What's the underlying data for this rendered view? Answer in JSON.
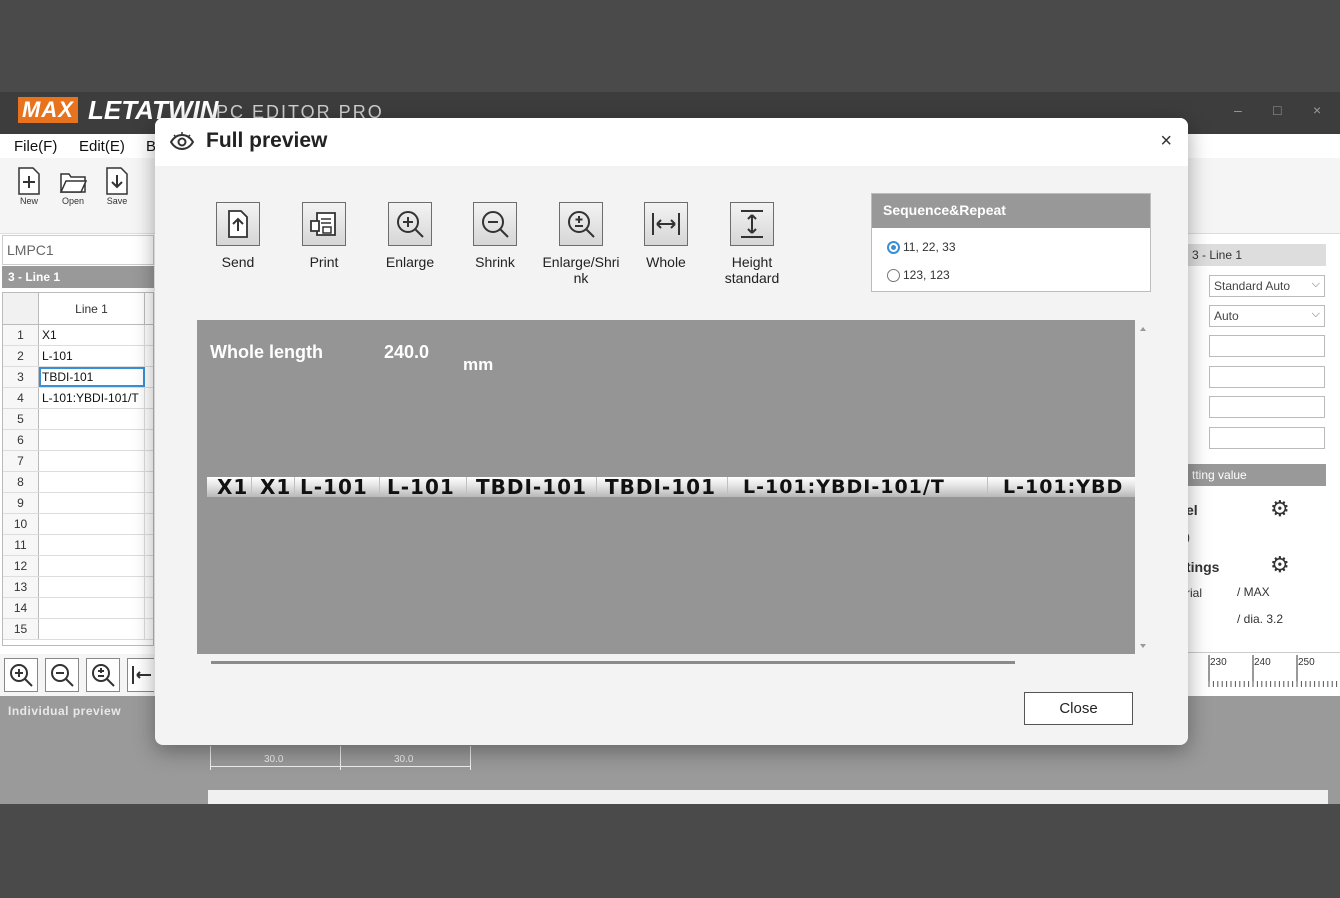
{
  "app": {
    "logo_max": "MAX",
    "logo_name": "LETATWIN",
    "logo_sub": "PC EDITOR PRO",
    "window_controls": [
      "–",
      "□",
      "×"
    ]
  },
  "menu": [
    "File(F)",
    "Edit(E)",
    "B"
  ],
  "toolbar": {
    "new_label": "New",
    "open_label": "Open",
    "save_label": "Save"
  },
  "file_name": "LMPC1",
  "section_header": "3 - Line 1",
  "grid": {
    "column_header": "Line 1",
    "rows": [
      {
        "n": "1",
        "v": "X1"
      },
      {
        "n": "2",
        "v": "L-101"
      },
      {
        "n": "3",
        "v": "TBDI-101"
      },
      {
        "n": "4",
        "v": "L-101:YBDI-101/T"
      },
      {
        "n": "5",
        "v": ""
      },
      {
        "n": "6",
        "v": ""
      },
      {
        "n": "7",
        "v": ""
      },
      {
        "n": "8",
        "v": ""
      },
      {
        "n": "9",
        "v": ""
      },
      {
        "n": "10",
        "v": ""
      },
      {
        "n": "11",
        "v": ""
      },
      {
        "n": "12",
        "v": ""
      },
      {
        "n": "13",
        "v": ""
      },
      {
        "n": "14",
        "v": ""
      },
      {
        "n": "15",
        "v": ""
      }
    ]
  },
  "individual_preview": {
    "label": "Individual preview",
    "dims": [
      "30.0",
      "30.0"
    ]
  },
  "right_panel": {
    "header": "3 - Line 1",
    "select1": "Standard Auto",
    "select2": "Auto",
    "setting_header": "tting value",
    "label_frag": "el",
    "paren_frag": ")",
    "settings_frag": "tings",
    "material_frag": "rial",
    "material_value": "/ MAX",
    "dia_value": "/ dia. 3.2",
    "ruler": [
      "230",
      "240",
      "250"
    ]
  },
  "dialog": {
    "title": "Full preview",
    "close_x": "×",
    "tools": [
      {
        "label": "Send",
        "icon": "send-icon"
      },
      {
        "label": "Print",
        "icon": "print-icon"
      },
      {
        "label": "Enlarge",
        "icon": "zoom-in-icon"
      },
      {
        "label": "Shrink",
        "icon": "zoom-out-icon"
      },
      {
        "label": "Enlarge/Shrink",
        "icon": "zoom-toggle-icon"
      },
      {
        "label": "Whole",
        "icon": "fit-width-icon"
      },
      {
        "label": "Height standard",
        "icon": "fit-height-icon"
      }
    ],
    "sequence": {
      "header": "Sequence&Repeat",
      "options": [
        "11, 22, 33",
        "123, 123"
      ],
      "selected": 0
    },
    "preview": {
      "whole_length_label": "Whole length",
      "whole_length_value": "240.0",
      "unit": "mm",
      "segments": [
        "X1",
        "X1",
        "L-101",
        "L-101",
        "TBDI-101",
        "TBDI-101",
        "L-101:YBDI-101/T",
        "L-101:YBD"
      ]
    },
    "close_button": "Close"
  }
}
